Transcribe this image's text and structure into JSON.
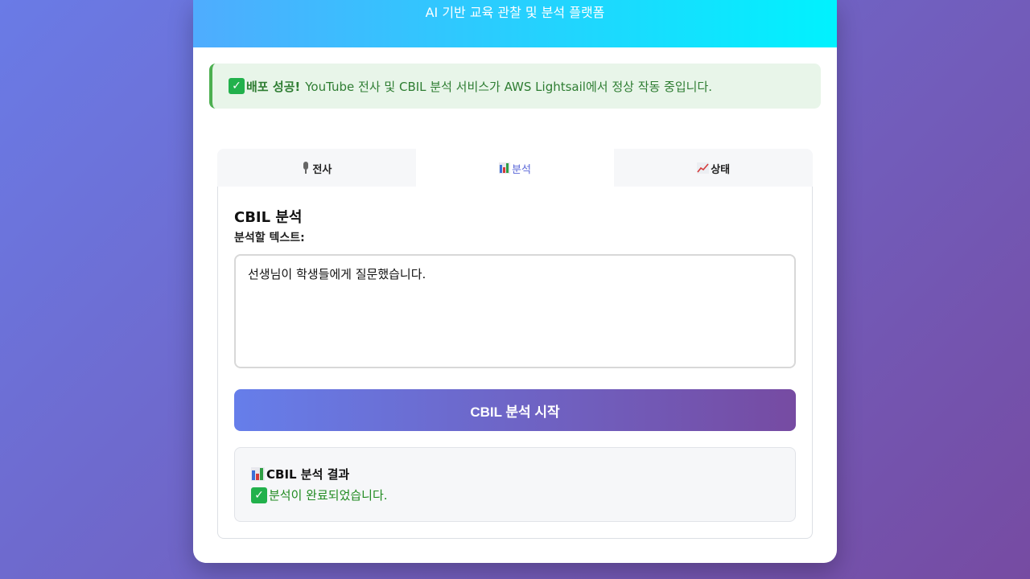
{
  "header": {
    "subtitle": "AI 기반 교육 관찰 및 분석 플랫폼"
  },
  "banner": {
    "icon": "check-mark-icon",
    "strong": "배포 성공!",
    "text": "YouTube 전사 및 CBIL 분석 서비스가 AWS Lightsail에서 정상 작동 중입니다."
  },
  "tabs": [
    {
      "label": "전사",
      "icon": "microphone-icon",
      "active": false
    },
    {
      "label": "분석",
      "icon": "bar-chart-icon",
      "active": true
    },
    {
      "label": "상태",
      "icon": "trend-chart-icon",
      "active": false
    }
  ],
  "analysis": {
    "title": "CBIL 분석",
    "input_label": "분석할 텍스트:",
    "input_value": "선생님이 학생들에게 질문했습니다.",
    "start_button": "CBIL 분석 시작"
  },
  "result": {
    "title": "CBIL 분석 결과",
    "message": "분석이 완료되었습니다."
  },
  "colors": {
    "accent": "#667eea",
    "accent_end": "#764ba2",
    "header_start": "#4facfe",
    "header_end": "#00f2fe",
    "success": "#2e7d32"
  }
}
